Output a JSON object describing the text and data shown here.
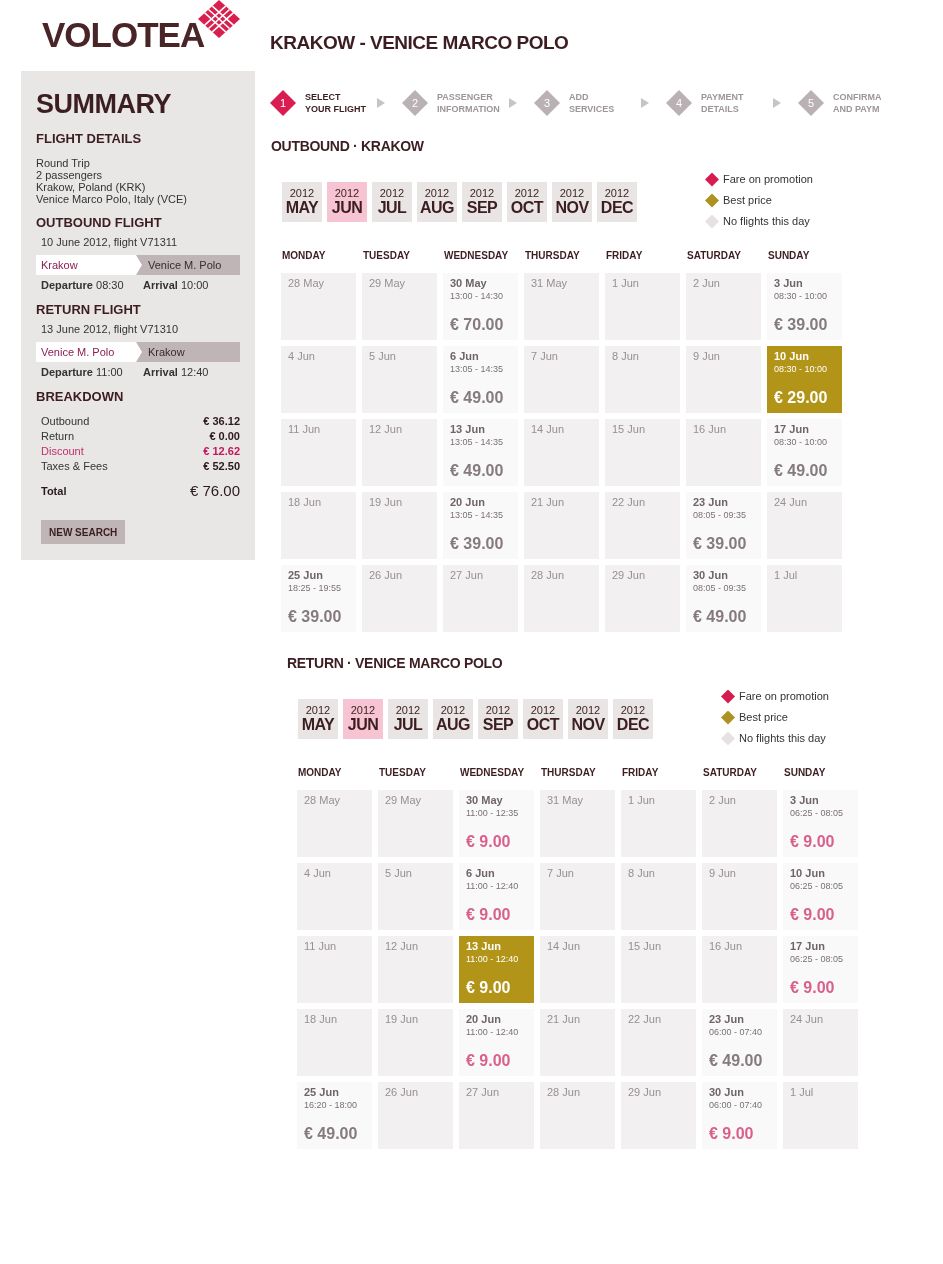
{
  "logo": {
    "text": "VOLOTEA"
  },
  "route_title": "KRAKOW - VENICE MARCO POLO",
  "summary": {
    "title": "SUMMARY",
    "flight_details": {
      "heading": "FLIGHT DETAILS",
      "lines": [
        "Round Trip",
        "2 passengers",
        "Krakow, Poland (KRK)",
        "Venice Marco Polo, Italy (VCE)"
      ]
    },
    "flights": [
      {
        "heading": "OUTBOUND FLIGHT",
        "date_line": "10 June 2012, flight V71311",
        "origin": "Krakow",
        "destination": "Venice M. Polo",
        "departure": "**Departure** 08:30",
        "arrival": "**Arrival** 10:00"
      },
      {
        "heading": "RETURN FLIGHT",
        "date_line": "13 June 2012, flight V71310",
        "origin": "Venice M. Polo",
        "destination": "Krakow",
        "departure": "**Departure** 11:00",
        "arrival": "**Arrival** 12:40"
      }
    ],
    "breakdown": {
      "heading": "BREAKDOWN",
      "rows": [
        {
          "label": "Outbound",
          "amount": "€ 36.12",
          "kind": "item"
        },
        {
          "label": "Return",
          "amount": "€ 0.00",
          "kind": "item"
        },
        {
          "label": "Discount",
          "amount": "€ 12.62",
          "kind": "discount"
        },
        {
          "label": "Taxes & Fees",
          "amount": "€ 52.50",
          "kind": "item"
        }
      ],
      "total_label": "Total",
      "total_amount": "€ 76.00"
    },
    "new_search_button": "NEW SEARCH"
  },
  "steps": [
    {
      "number": "1",
      "lines": [
        "SELECT",
        "YOUR FLIGHT"
      ],
      "selected": true
    },
    {
      "number": "2",
      "lines": [
        "PASSENGER",
        "INFORMATION"
      ],
      "selected": false
    },
    {
      "number": "3",
      "lines": [
        "ADD",
        "SERVICES"
      ],
      "selected": false
    },
    {
      "number": "4",
      "lines": [
        "PAYMENT",
        "DETAILS"
      ],
      "selected": false
    },
    {
      "number": "5",
      "lines": [
        "CONFIRMA",
        "AND PAYM"
      ],
      "selected": false
    }
  ],
  "calendars": [
    {
      "heading": "OUTBOUND · KRAKOW",
      "months": [
        {
          "year": "2012",
          "month": "MAY",
          "selected": false
        },
        {
          "year": "2012",
          "month": "JUN",
          "selected": true
        },
        {
          "year": "2012",
          "month": "JUL",
          "selected": false
        },
        {
          "year": "2012",
          "month": "AUG",
          "selected": false
        },
        {
          "year": "2012",
          "month": "SEP",
          "selected": false
        },
        {
          "year": "2012",
          "month": "OCT",
          "selected": false
        },
        {
          "year": "2012",
          "month": "NOV",
          "selected": false
        },
        {
          "year": "2012",
          "month": "DEC",
          "selected": false
        }
      ],
      "legend": [
        {
          "label": "Fare on promotion",
          "color": "#d81b4f"
        },
        {
          "label": "Best price",
          "color": "#ad9220"
        },
        {
          "label": "No flights this day",
          "color": "#e6e2e3"
        }
      ],
      "weekdays": [
        "MONDAY",
        "TUESDAY",
        "WEDNESDAY",
        "THURSDAY",
        "FRIDAY",
        "SATURDAY",
        "SUNDAY"
      ],
      "weeks": [
        [
          {
            "kind": "none",
            "date": "28 May",
            "selected": false
          },
          {
            "kind": "none",
            "date": "29 May",
            "selected": false
          },
          {
            "kind": "flight",
            "date": "30 May",
            "time": "13:00 - 14:30",
            "price": "€ 70.00",
            "promo": false,
            "selected": false
          },
          {
            "kind": "none",
            "date": "31 May",
            "selected": false
          },
          {
            "kind": "none",
            "date": "1 Jun",
            "selected": false
          },
          {
            "kind": "none",
            "date": "2 Jun",
            "selected": false
          },
          {
            "kind": "flight",
            "date": "3 Jun",
            "time": "08:30 - 10:00",
            "price": "€ 39.00",
            "promo": false,
            "selected": false
          }
        ],
        [
          {
            "kind": "none",
            "date": "4 Jun",
            "selected": false
          },
          {
            "kind": "none",
            "date": "5 Jun",
            "selected": false
          },
          {
            "kind": "flight",
            "date": "6 Jun",
            "time": "13:05 - 14:35",
            "price": "€ 49.00",
            "promo": false,
            "selected": false
          },
          {
            "kind": "none",
            "date": "7 Jun",
            "selected": false
          },
          {
            "kind": "none",
            "date": "8 Jun",
            "selected": false
          },
          {
            "kind": "none",
            "date": "9 Jun",
            "selected": false
          },
          {
            "kind": "flight",
            "date": "10 Jun",
            "time": "08:30 - 10:00",
            "price": "€ 29.00",
            "selected": true
          }
        ],
        [
          {
            "kind": "none",
            "date": "11 Jun",
            "selected": false
          },
          {
            "kind": "none",
            "date": "12 Jun",
            "selected": false
          },
          {
            "kind": "flight",
            "date": "13 Jun",
            "time": "13:05 - 14:35",
            "price": "€ 49.00",
            "promo": false,
            "selected": false
          },
          {
            "kind": "none",
            "date": "14 Jun",
            "selected": false
          },
          {
            "kind": "none",
            "date": "15 Jun",
            "selected": false
          },
          {
            "kind": "none",
            "date": "16 Jun",
            "selected": false
          },
          {
            "kind": "flight",
            "date": "17 Jun",
            "time": "08:30 - 10:00",
            "price": "€ 49.00",
            "promo": false,
            "selected": false
          }
        ],
        [
          {
            "kind": "none",
            "date": "18 Jun",
            "selected": false
          },
          {
            "kind": "none",
            "date": "19 Jun",
            "selected": false
          },
          {
            "kind": "flight",
            "date": "20 Jun",
            "time": "13:05 - 14:35",
            "price": "€ 39.00",
            "promo": false,
            "selected": false
          },
          {
            "kind": "none",
            "date": "21 Jun",
            "selected": false
          },
          {
            "kind": "none",
            "date": "22 Jun",
            "selected": false
          },
          {
            "kind": "flight",
            "date": "23 Jun",
            "time": "08:05 - 09:35",
            "price": "€ 39.00",
            "promo": false,
            "selected": false
          },
          {
            "kind": "none",
            "date": "24 Jun",
            "selected": false
          }
        ],
        [
          {
            "kind": "flight",
            "date": "25 Jun",
            "time": "18:25 - 19:55",
            "price": "€ 39.00",
            "promo": false,
            "selected": false
          },
          {
            "kind": "none",
            "date": "26 Jun",
            "selected": false
          },
          {
            "kind": "none",
            "date": "27 Jun",
            "selected": false
          },
          {
            "kind": "none",
            "date": "28 Jun",
            "selected": false
          },
          {
            "kind": "none",
            "date": "29 Jun",
            "selected": false
          },
          {
            "kind": "flight",
            "date": "30 Jun",
            "time": "08:05 - 09:35",
            "price": "€ 49.00",
            "promo": false,
            "selected": false
          },
          {
            "kind": "none",
            "date": "1 Jul",
            "selected": false
          }
        ]
      ]
    },
    {
      "heading": "RETURN · VENICE MARCO POLO",
      "months": [
        {
          "year": "2012",
          "month": "MAY",
          "selected": false
        },
        {
          "year": "2012",
          "month": "JUN",
          "selected": true
        },
        {
          "year": "2012",
          "month": "JUL",
          "selected": false
        },
        {
          "year": "2012",
          "month": "AUG",
          "selected": false
        },
        {
          "year": "2012",
          "month": "SEP",
          "selected": false
        },
        {
          "year": "2012",
          "month": "OCT",
          "selected": false
        },
        {
          "year": "2012",
          "month": "NOV",
          "selected": false
        },
        {
          "year": "2012",
          "month": "DEC",
          "selected": false
        }
      ],
      "legend": [
        {
          "label": "Fare on promotion",
          "color": "#d81b4f"
        },
        {
          "label": "Best price",
          "color": "#ad9220"
        },
        {
          "label": "No flights this day",
          "color": "#e6e2e3"
        }
      ],
      "weekdays": [
        "MONDAY",
        "TUESDAY",
        "WEDNESDAY",
        "THURSDAY",
        "FRIDAY",
        "SATURDAY",
        "SUNDAY"
      ],
      "weeks": [
        [
          {
            "kind": "none",
            "date": "28 May",
            "selected": false
          },
          {
            "kind": "none",
            "date": "29 May",
            "selected": false
          },
          {
            "kind": "flight",
            "date": "30 May",
            "time": "11:00 - 12:35",
            "price": "€ 9.00",
            "promo": true,
            "selected": false
          },
          {
            "kind": "none",
            "date": "31 May",
            "selected": false
          },
          {
            "kind": "none",
            "date": "1 Jun",
            "selected": false
          },
          {
            "kind": "none",
            "date": "2 Jun",
            "selected": false
          },
          {
            "kind": "flight",
            "date": "3 Jun",
            "time": "06:25 - 08:05",
            "price": "€ 9.00",
            "promo": true,
            "selected": false
          }
        ],
        [
          {
            "kind": "none",
            "date": "4 Jun",
            "selected": false
          },
          {
            "kind": "none",
            "date": "5 Jun",
            "selected": false
          },
          {
            "kind": "flight",
            "date": "6 Jun",
            "time": "11:00 - 12:40",
            "price": "€ 9.00",
            "promo": true,
            "selected": false
          },
          {
            "kind": "none",
            "date": "7 Jun",
            "selected": false
          },
          {
            "kind": "none",
            "date": "8 Jun",
            "selected": false
          },
          {
            "kind": "none",
            "date": "9 Jun",
            "selected": false
          },
          {
            "kind": "flight",
            "date": "10 Jun",
            "time": "06:25 - 08:05",
            "price": "€ 9.00",
            "promo": true,
            "selected": false
          }
        ],
        [
          {
            "kind": "none",
            "date": "11 Jun",
            "selected": false
          },
          {
            "kind": "none",
            "date": "12 Jun",
            "selected": false
          },
          {
            "kind": "flight",
            "date": "13 Jun",
            "time": "11:00 - 12:40",
            "price": "€ 9.00",
            "selected": true
          },
          {
            "kind": "none",
            "date": "14 Jun",
            "selected": false
          },
          {
            "kind": "none",
            "date": "15 Jun",
            "selected": false
          },
          {
            "kind": "none",
            "date": "16 Jun",
            "selected": false
          },
          {
            "kind": "flight",
            "date": "17 Jun",
            "time": "06:25 - 08:05",
            "price": "€ 9.00",
            "promo": true,
            "selected": false
          }
        ],
        [
          {
            "kind": "none",
            "date": "18 Jun",
            "selected": false
          },
          {
            "kind": "none",
            "date": "19 Jun",
            "selected": false
          },
          {
            "kind": "flight",
            "date": "20 Jun",
            "time": "11:00 - 12:40",
            "price": "€ 9.00",
            "promo": true,
            "selected": false
          },
          {
            "kind": "none",
            "date": "21 Jun",
            "selected": false
          },
          {
            "kind": "none",
            "date": "22 Jun",
            "selected": false
          },
          {
            "kind": "flight",
            "date": "23 Jun",
            "time": "06:00 - 07:40",
            "price": "€ 49.00",
            "promo": false,
            "selected": false
          },
          {
            "kind": "none",
            "date": "24 Jun",
            "selected": false
          }
        ],
        [
          {
            "kind": "flight",
            "date": "25 Jun",
            "time": "16:20 - 18:00",
            "price": "€ 49.00",
            "promo": false,
            "selected": false
          },
          {
            "kind": "none",
            "date": "26 Jun",
            "selected": false
          },
          {
            "kind": "none",
            "date": "27 Jun",
            "selected": false
          },
          {
            "kind": "none",
            "date": "28 Jun",
            "selected": false
          },
          {
            "kind": "none",
            "date": "29 Jun",
            "selected": false
          },
          {
            "kind": "flight",
            "date": "30 Jun",
            "time": "06:00 - 07:40",
            "price": "€ 9.00",
            "promo": true,
            "selected": false
          },
          {
            "kind": "none",
            "date": "1 Jul",
            "selected": false
          }
        ]
      ]
    }
  ]
}
